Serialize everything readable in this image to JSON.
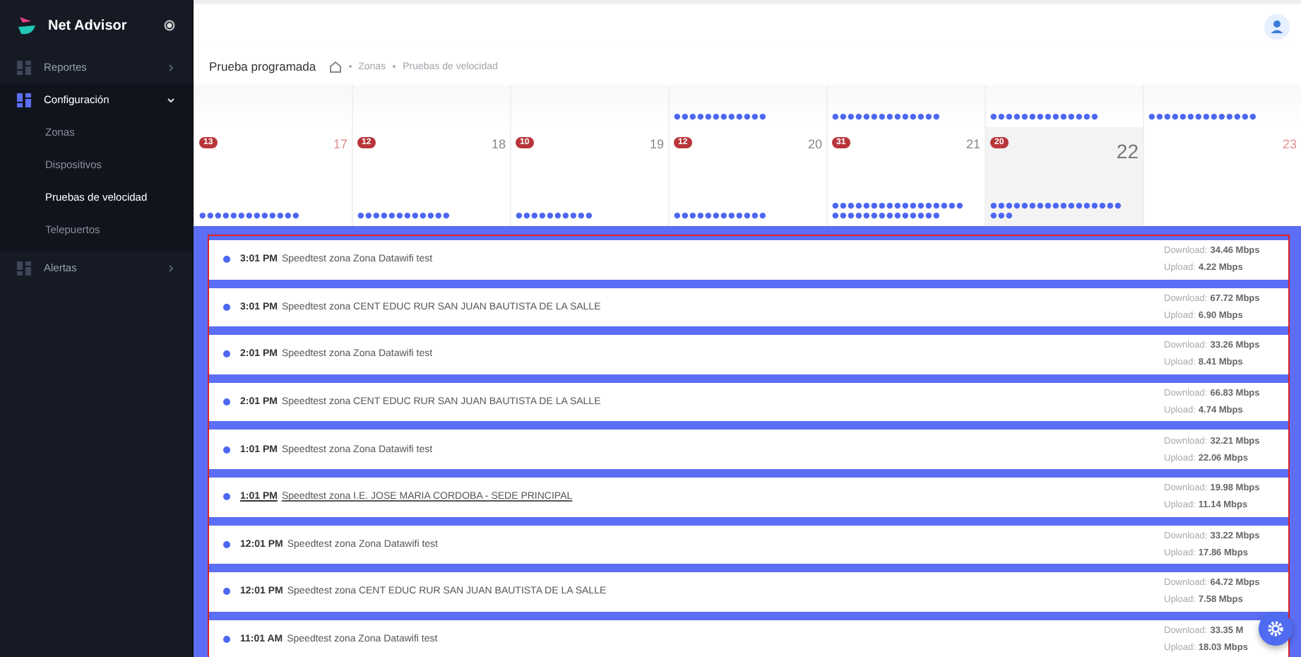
{
  "sidebar": {
    "app_name": "Net Advisor",
    "items": [
      {
        "label": "Reportes",
        "expanded": false,
        "active": false
      },
      {
        "label": "Configuración",
        "expanded": true,
        "active": true,
        "children": [
          {
            "label": "Zonas",
            "selected": false
          },
          {
            "label": "Dispositivos",
            "selected": false
          },
          {
            "label": "Pruebas de velocidad",
            "selected": true
          },
          {
            "label": "Telepuertos",
            "selected": false
          }
        ]
      },
      {
        "label": "Alertas",
        "expanded": false,
        "active": false
      }
    ]
  },
  "page": {
    "title": "Prueba programada",
    "breadcrumb": [
      "Zonas",
      "Pruebas de velocidad"
    ]
  },
  "calendar": {
    "weeks": [
      {
        "days": [
          {
            "kind": "empty"
          },
          {
            "kind": "empty"
          },
          {
            "kind": "empty"
          },
          {
            "kind": "day",
            "dots": "●●●●●●●●●●●●"
          },
          {
            "kind": "day",
            "dots": "●●●●●●●●●●●●●●"
          },
          {
            "kind": "day",
            "dots": "●●●●●●●●●●●●●●"
          },
          {
            "kind": "day",
            "dots": "●●●●●●●●●●●●●●"
          }
        ]
      },
      {
        "days": [
          {
            "kind": "day",
            "number": "17",
            "badge": "13",
            "weekend": true,
            "selected": false,
            "dots": "●●●●●●●●●●●●●"
          },
          {
            "kind": "day",
            "number": "18",
            "badge": "12",
            "weekend": false,
            "selected": false,
            "dots": "●●●●●●●●●●●●"
          },
          {
            "kind": "day",
            "number": "19",
            "badge": "10",
            "weekend": false,
            "selected": false,
            "dots": "●●●●●●●●●●"
          },
          {
            "kind": "day",
            "number": "20",
            "badge": "12",
            "weekend": false,
            "selected": false,
            "dots": "●●●●●●●●●●●●"
          },
          {
            "kind": "day",
            "number": "21",
            "badge": "31",
            "weekend": false,
            "selected": false,
            "dots": "●●●●●●●●●●●●●●●●●●●●●●●●●●●●●●●"
          },
          {
            "kind": "day",
            "number": "22",
            "badge": "20",
            "weekend": false,
            "selected": true,
            "dots": "●●●●●●●●●●●●●●●●●●●●"
          },
          {
            "kind": "day",
            "number": "23",
            "weekend": true,
            "selected": false
          }
        ]
      }
    ]
  },
  "events": [
    {
      "time": "3:01 PM",
      "title": "Speedtest zona Zona Datawifi test",
      "download_label": "Download:",
      "download": "34.46 Mbps",
      "upload_label": "Upload:",
      "upload": "4.22 Mbps",
      "hovered": false
    },
    {
      "time": "3:01 PM",
      "title": "Speedtest zona CENT EDUC RUR SAN JUAN BAUTISTA DE LA SALLE",
      "download_label": "Download:",
      "download": "67.72 Mbps",
      "upload_label": "Upload:",
      "upload": "6.90 Mbps",
      "hovered": false
    },
    {
      "time": "2:01 PM",
      "title": "Speedtest zona Zona Datawifi test",
      "download_label": "Download:",
      "download": "33.26 Mbps",
      "upload_label": "Upload:",
      "upload": "8.41 Mbps",
      "hovered": false
    },
    {
      "time": "2:01 PM",
      "title": "Speedtest zona CENT EDUC RUR SAN JUAN BAUTISTA DE LA SALLE",
      "download_label": "Download:",
      "download": "66.83 Mbps",
      "upload_label": "Upload:",
      "upload": "4.74 Mbps",
      "hovered": false
    },
    {
      "time": "1:01 PM",
      "title": "Speedtest zona Zona Datawifi test",
      "download_label": "Download:",
      "download": "32.21 Mbps",
      "upload_label": "Upload:",
      "upload": "22.06 Mbps",
      "hovered": false
    },
    {
      "time": "1:01 PM",
      "title": "Speedtest zona I.E. JOSE MARIA CORDOBA - SEDE PRINCIPAL",
      "download_label": "Download:",
      "download": "19.98 Mbps",
      "upload_label": "Upload:",
      "upload": "11.14 Mbps",
      "hovered": true
    },
    {
      "time": "12:01 PM",
      "title": "Speedtest zona Zona Datawifi test",
      "download_label": "Download:",
      "download": "33.22 Mbps",
      "upload_label": "Upload:",
      "upload": "17.86 Mbps",
      "hovered": false
    },
    {
      "time": "12:01 PM",
      "title": "Speedtest zona CENT EDUC RUR SAN JUAN BAUTISTA DE LA SALLE",
      "download_label": "Download:",
      "download": "64.72 Mbps",
      "upload_label": "Upload:",
      "upload": "7.58 Mbps",
      "hovered": false
    },
    {
      "time": "11:01 AM",
      "title": "Speedtest zona Zona Datawifi test",
      "download_label": "Download:",
      "download": "33.35 M",
      "upload_label": "Upload:",
      "upload": "18.03 Mbps",
      "hovered": false
    }
  ]
}
